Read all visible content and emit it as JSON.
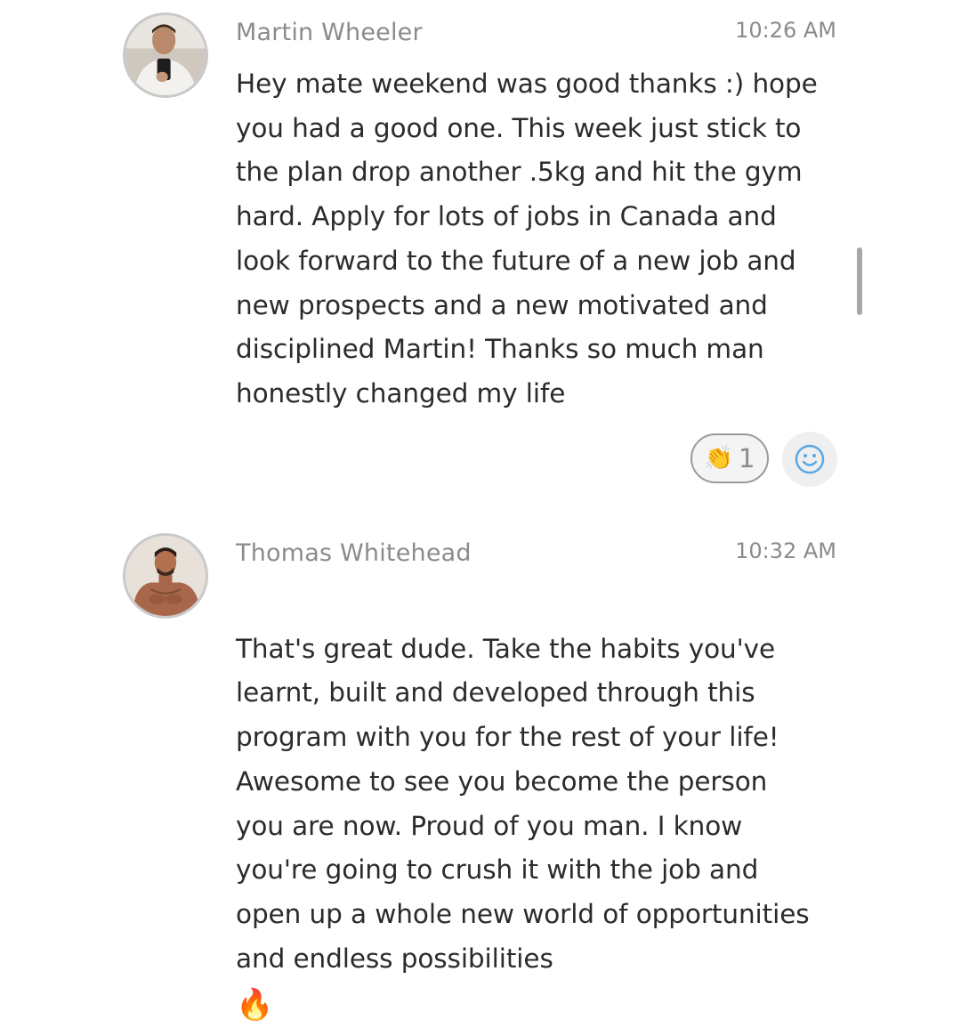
{
  "messages": [
    {
      "sender": "Martin Wheeler",
      "time": "10:26 AM",
      "text": "Hey mate weekend was good thanks :) hope\nyou had a good one. This week just stick to\nthe plan drop another .5kg and hit the gym\nhard. Apply for lots of jobs in Canada and\nlook forward to the future of a new job and\nnew prospects and a new motivated and\ndisciplined Martin! Thanks so much man\nhonestly changed my life",
      "avatar_icon": "user-avatar-mirror-selfie",
      "reactions": [
        {
          "emoji": "👏",
          "icon": "clapping-hands-icon",
          "count": "1"
        }
      ],
      "add_reaction_icon": "smiley-add-reaction-icon"
    },
    {
      "sender": "Thomas Whitehead",
      "time": "10:32 AM",
      "text": "That's great dude. Take the habits you've\nlearnt, built and developed through this\nprogram with you for the rest of your life!\nAwesome to see you become the person\nyou are now. Proud of you man. I know\nyou're going to crush it with the job and\nopen up a whole new world of opportunities\nand endless possibilities",
      "trailing_emoji": "🔥",
      "avatar_icon": "user-avatar-shirtless"
    }
  ],
  "colors": {
    "meta_text": "#8b8b8b",
    "body_text": "#2b2b2b",
    "avatar_ring": "#c9c9c9",
    "smiley_blue": "#5aa9e6"
  }
}
